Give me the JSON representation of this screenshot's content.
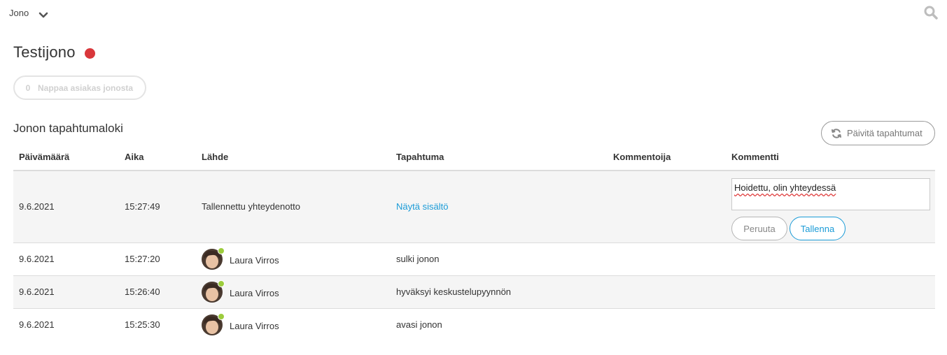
{
  "header": {
    "queue_label": "Jono",
    "icons": {
      "dropdown": "chevron-down-icon",
      "search": "search-icon"
    }
  },
  "queue": {
    "title": "Testijono",
    "status_color": "#d9373b",
    "grab_count": "0",
    "grab_label": "Nappaa asiakas jonosta"
  },
  "log": {
    "title": "Jonon tapahtumaloki",
    "refresh_label": "Päivitä tapahtumat",
    "columns": [
      "Päivämäärä",
      "Aika",
      "Lähde",
      "Tapahtuma",
      "Kommentoija",
      "Kommentti"
    ],
    "rows": [
      {
        "date": "9.6.2021",
        "time": "15:27:49",
        "source": "Tallennettu yhteydenotto",
        "event": "Näytä sisältö",
        "commenter": "",
        "comment_value": "Hoidettu, olin yhteydessä",
        "cancel_label": "Peruuta",
        "save_label": "Tallenna"
      },
      {
        "date": "9.6.2021",
        "time": "15:27:20",
        "source": "Laura Virros",
        "event": "sulki jonon",
        "commenter": "",
        "comment": ""
      },
      {
        "date": "9.6.2021",
        "time": "15:26:40",
        "source": "Laura Virros",
        "event": "hyväksyi keskustelupyynnön",
        "commenter": "",
        "comment": ""
      },
      {
        "date": "9.6.2021",
        "time": "15:25:30",
        "source": "Laura Virros",
        "event": "avasi jonon",
        "commenter": "",
        "comment": ""
      }
    ]
  },
  "colors": {
    "accent": "#1a9bd7",
    "presence_online": "#9ccc3c",
    "row_alt": "#f5f5f5"
  }
}
